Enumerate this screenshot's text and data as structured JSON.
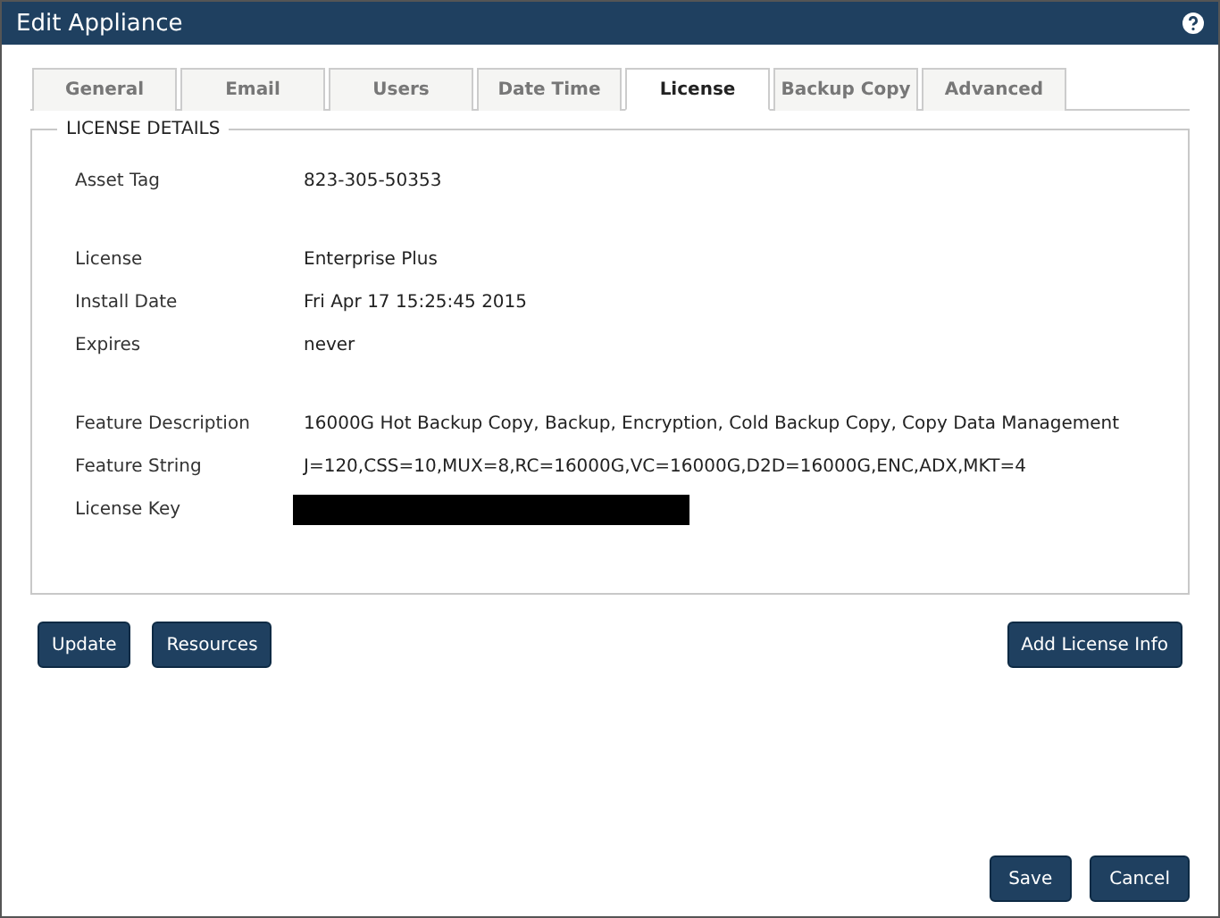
{
  "window": {
    "title": "Edit Appliance"
  },
  "tabs": [
    {
      "label": "General",
      "selected": false
    },
    {
      "label": "Email",
      "selected": false
    },
    {
      "label": "Users",
      "selected": false
    },
    {
      "label": "Date Time",
      "selected": false
    },
    {
      "label": "License",
      "selected": true
    },
    {
      "label": "Backup Copy",
      "selected": false
    },
    {
      "label": "Advanced",
      "selected": false
    }
  ],
  "section": {
    "title": "LICENSE DETAILS",
    "groups": [
      [
        {
          "label": "Asset Tag",
          "kind": "text",
          "value": "823-305-50353"
        }
      ],
      [
        {
          "label": "License",
          "kind": "text",
          "value": "Enterprise Plus"
        },
        {
          "label": "Install Date",
          "kind": "text",
          "value": "Fri Apr 17 15:25:45 2015"
        },
        {
          "label": "Expires",
          "kind": "text",
          "value": "never"
        }
      ],
      [
        {
          "label": "Feature Description",
          "kind": "text",
          "value": "16000G Hot Backup Copy, Backup, Encryption, Cold Backup Copy, Copy Data Management"
        },
        {
          "label": "Feature String",
          "kind": "text",
          "value": "J=120,CSS=10,MUX=8,RC=16000G,VC=16000G,D2D=16000G,ENC,ADX,MKT=4"
        },
        {
          "label": "License Key",
          "kind": "redacted"
        }
      ]
    ]
  },
  "left_buttons": [
    "Update",
    "Resources"
  ],
  "right_button": "Add License Info",
  "footer_buttons": [
    "Save",
    "Cancel"
  ]
}
